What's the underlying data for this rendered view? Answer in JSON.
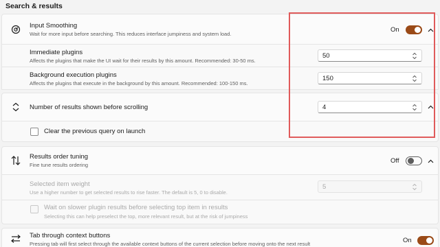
{
  "section": {
    "title": "Search & results"
  },
  "input_smoothing": {
    "icon": "gauge-icon",
    "title": "Input Smoothing",
    "description": "Wait for more input before searching. This reduces interface jumpiness and system load.",
    "toggle_label": "On",
    "toggle_state": "on",
    "immediate": {
      "title": "Immediate plugins",
      "description": "Affects the plugins that make the UI wait for their results by this amount. Recommended: 30-50 ms.",
      "value": "50"
    },
    "background": {
      "title": "Background execution plugins",
      "description": "Affects the plugins that execute in the background by this amount. Recommended: 100-150 ms.",
      "value": "150"
    }
  },
  "results_count": {
    "icon": "expand-vertical-icon",
    "title": "Number of results shown before scrolling",
    "value": "4",
    "clear_query_label": "Clear the previous query on launch",
    "clear_query_checked": false
  },
  "results_order": {
    "icon": "sort-arrows-icon",
    "title": "Results order tuning",
    "description": "Fine tune results ordering",
    "toggle_label": "Off",
    "toggle_state": "off",
    "selected_weight": {
      "title": "Selected item weight",
      "description": "Use a higher number to get selected results to rise faster. The default is 5, 0 to disable.",
      "value": "5"
    },
    "wait_slower": {
      "label": "Wait on slower plugin results before selecting top item in results",
      "description": "Selecting this can help preselect the top, more relevant result, but at the risk of jumpiness"
    }
  },
  "tab_context": {
    "icon": "tab-arrow-icon",
    "title": "Tab through context buttons",
    "description": "Pressing tab will first select through the available context buttons of the current selection before moving onto the next result",
    "toggle_label": "On",
    "toggle_state": "on"
  },
  "colors": {
    "accent": "#9a4a17",
    "highlight": "#e05a5a"
  }
}
